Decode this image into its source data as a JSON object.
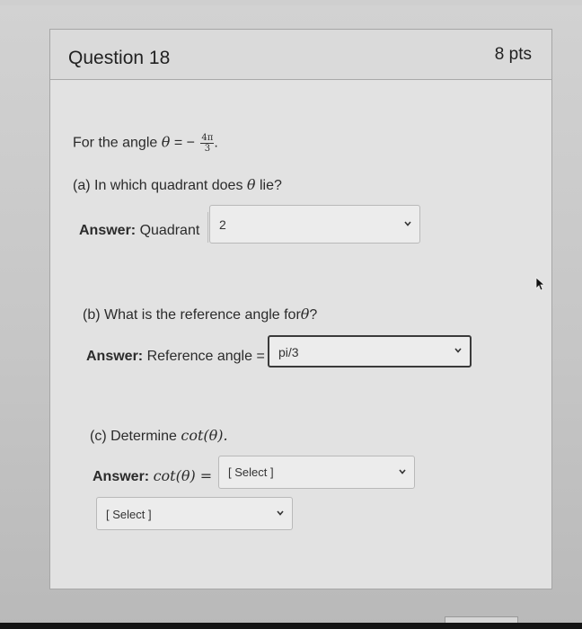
{
  "question": {
    "title": "Question 18",
    "points": "8 pts",
    "prompt_prefix": "For the angle",
    "theta": "θ",
    "equals_minus": "= −",
    "frac_num": "4π",
    "frac_den": "3",
    "period": "."
  },
  "part_a": {
    "question": "(a) In which quadrant does",
    "theta": "θ",
    "suffix": "lie?",
    "answer_label": "Answer:",
    "answer_prefix": "Quadrant",
    "selected": "2"
  },
  "part_b": {
    "question": "(b) What is the reference angle for",
    "theta": "θ",
    "suffix": "?",
    "answer_label": "Answer:",
    "answer_prefix": "Reference angle =",
    "selected": "pi/3"
  },
  "part_c": {
    "question": "(c) Determine",
    "func": "cot(θ).",
    "answer_label": "Answer:",
    "answer_expr": "cot(θ) =",
    "selected_1": "[ Select ]",
    "selected_2": "[ Select ]"
  },
  "icons": {
    "dropdown": "chevron-down-icon",
    "cursor": "mouse-pointer-icon"
  }
}
